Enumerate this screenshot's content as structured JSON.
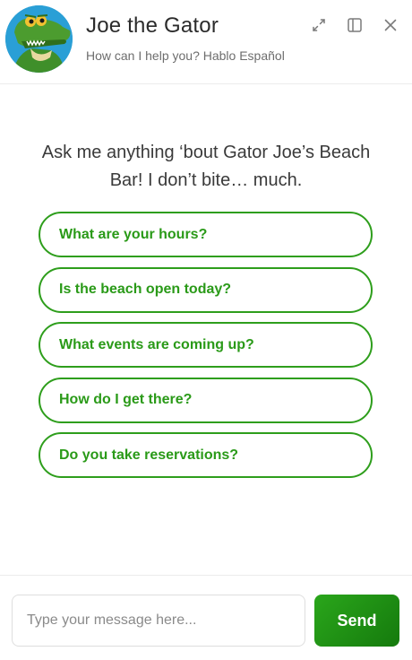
{
  "header": {
    "title": "Joe the Gator",
    "subtitle": "How can I help you? Hablo Español",
    "avatar_icon": "gator-mascot-avatar",
    "actions": [
      {
        "icon": "expand-icon"
      },
      {
        "icon": "sidebar-panel-icon"
      },
      {
        "icon": "close-icon"
      }
    ]
  },
  "welcome": {
    "message": "Ask me anything ‘bout Gator Joe’s Beach Bar! I don’t bite… much."
  },
  "suggestions": [
    {
      "label": "What are your hours?"
    },
    {
      "label": "Is the beach open today?"
    },
    {
      "label": "What events are coming up?"
    },
    {
      "label": "How do I get there?"
    },
    {
      "label": "Do you take reservations?"
    }
  ],
  "composer": {
    "placeholder": "Type your message here...",
    "value": "",
    "send_label": "Send"
  },
  "colors": {
    "accent": "#2a9a18",
    "send_gradient_start": "#2aa61b",
    "send_gradient_end": "#157a0d",
    "avatar_bg": "#2a9fd6"
  }
}
